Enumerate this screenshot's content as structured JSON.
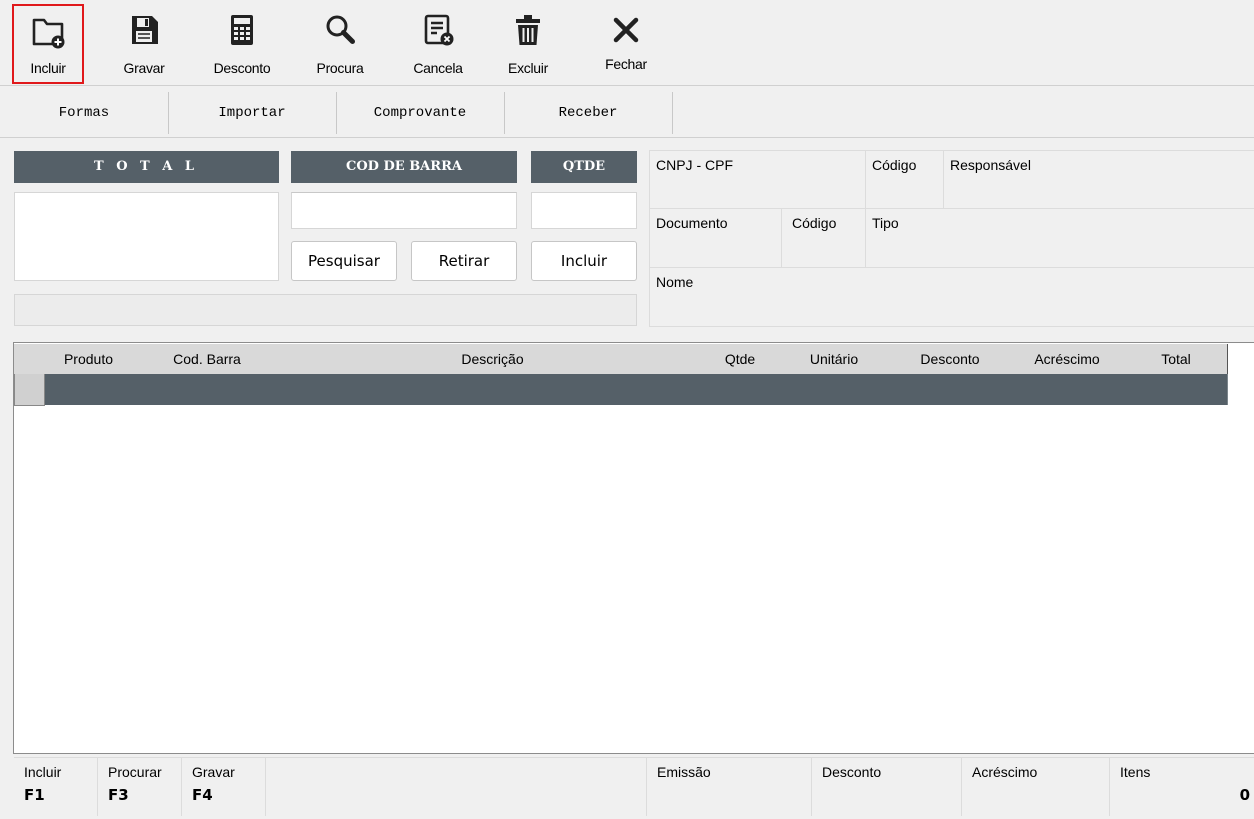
{
  "toolbar": {
    "incluir": "Incluir",
    "gravar": "Gravar",
    "desconto": "Desconto",
    "procura": "Procura",
    "cancela": "Cancela",
    "excluir": "Excluir",
    "fechar": "Fechar"
  },
  "menu": {
    "formas": "Formas",
    "importar": "Importar",
    "comprovante": "Comprovante",
    "receber": "Receber"
  },
  "entry": {
    "total_header": "T O T A L",
    "total_value": "",
    "barcode_header": "COD DE BARRA",
    "barcode_value": "",
    "qty_header": "QTDE",
    "qty_value": "",
    "search_button": "Pesquisar",
    "remove_button": "Retirar",
    "include_button": "Incluir",
    "message": ""
  },
  "customer": {
    "cnpj_cpf_label": "CNPJ - CPF",
    "codigo_label": "Código",
    "responsavel_label": "Responsável",
    "documento_label": "Documento",
    "codigo2_label": "Código",
    "tipo_label": "Tipo",
    "nome_label": "Nome"
  },
  "grid": {
    "columns": [
      "Produto",
      "Cod. Barra",
      "Descrição",
      "Qtde",
      "Unitário",
      "Desconto",
      "Acréscimo",
      "Total"
    ]
  },
  "status": {
    "shortcuts": [
      {
        "label": "Incluir",
        "key": "F1"
      },
      {
        "label": "Procurar",
        "key": "F3"
      },
      {
        "label": "Gravar",
        "key": "F4"
      }
    ],
    "emissao_label": "Emissão",
    "desconto_label": "Desconto",
    "acrescimo_label": "Acréscimo",
    "itens_label": "Itens",
    "itens_value": "0"
  },
  "colors": {
    "header_bg": "#556068",
    "selection_border": "#e0191b"
  }
}
